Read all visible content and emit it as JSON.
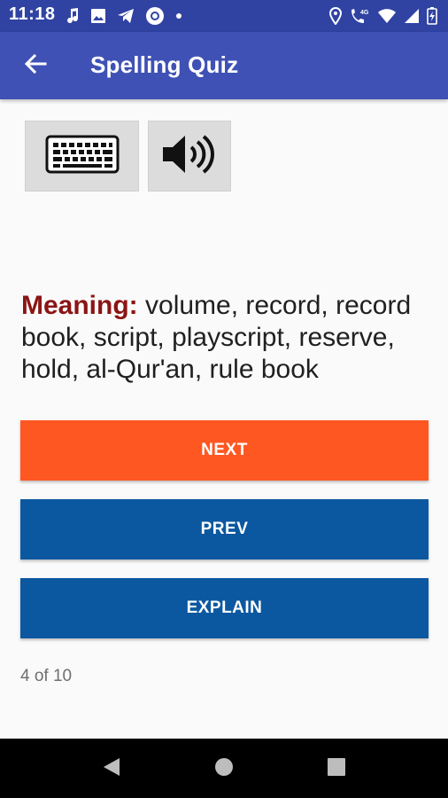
{
  "status_bar": {
    "time": "11:18",
    "left_icons": [
      "music-note-icon",
      "image-icon",
      "telegram-icon",
      "circle-record-icon",
      "dot-icon"
    ],
    "right_icons": [
      "location-icon",
      "wifi-calling-icon",
      "wifi-icon",
      "signal-icon",
      "battery-icon"
    ],
    "network_label": "4G"
  },
  "app_bar": {
    "title": "Spelling Quiz",
    "back_icon": "arrow-back-icon"
  },
  "tools": {
    "keyboard_icon": "keyboard-icon",
    "speaker_icon": "speaker-icon"
  },
  "question": {
    "meaning_label": "Meaning:",
    "meaning_text": " volume, record, record book, script, playscript, reserve, hold, al-Qur'an, rule book"
  },
  "buttons": {
    "next_label": "NEXT",
    "prev_label": "PREV",
    "explain_label": "EXPLAIN"
  },
  "progress": {
    "text": "4 of 10",
    "current": 4,
    "total": 10
  },
  "colors": {
    "status_bar": "#3043a3",
    "app_bar": "#3f51b5",
    "next_button": "#ff5722",
    "prev_button": "#0b58a0",
    "explain_button": "#0b58a0",
    "meaning_label": "#8b1414"
  }
}
